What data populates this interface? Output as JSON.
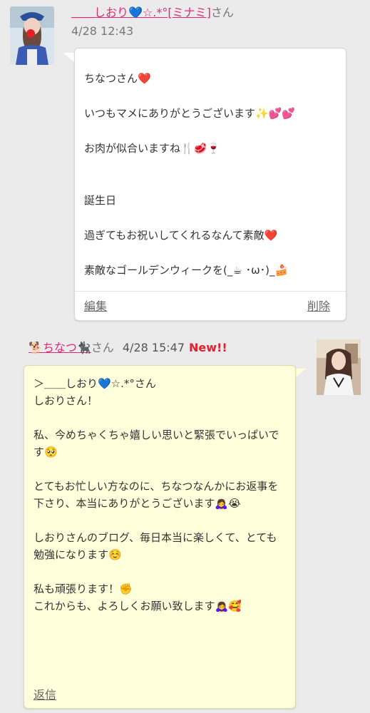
{
  "comment1": {
    "author": "＿＿しおり💙☆.*°[ミナミ]",
    "honorific": "さん",
    "date": "4/28 12:43",
    "lines": [
      "ちなつさん❤️",
      "いつもマメにありがとうございます✨💕💕",
      "お肉が似合いますね🍴🥩🍷",
      "誕生日",
      "過ぎてもお祝いしてくれるなんて素敵❤️",
      "素敵なゴールデンウィークを(_☕ ･ω･)_🍰"
    ],
    "edit_label": "編集",
    "delete_label": "削除"
  },
  "comment2": {
    "author": "🐕ちなつ🐈‍⬛",
    "honorific": "さん",
    "date": "4/28 15:47",
    "new_label": "New!!",
    "lines": [
      "＞＿＿しおり💙☆.*°さん",
      "しおりさん！",
      "私、今めちゃくちゃ嬉しい思いと緊張でいっぱいです🥺",
      "とてもお忙しい方なのに、ちなつなんかにお返事を下さり、本当にありがとうございます🙇‍♀️😭",
      "しおりさんのブログ、毎日本当に楽しくて、とても勉強になります☺️",
      "私も頑張ります！✊",
      "これからも、よろしくお願い致します🙇‍♀️🥰"
    ],
    "reply_label": "返信"
  },
  "colors": {
    "page_bg": "#ebebeb",
    "link_pink": "#e0287a",
    "new_red": "#e3202f",
    "reply_bubble_bg": "#ffffdc"
  }
}
